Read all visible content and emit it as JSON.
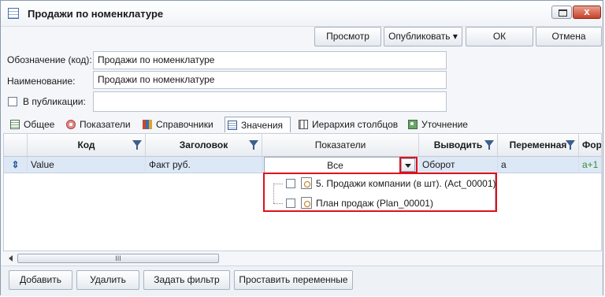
{
  "window": {
    "title": "Продажи по номенклатуре",
    "close_label": "x"
  },
  "toolbar": {
    "preview_label": "Просмотр",
    "publish_label": "Опубликовать ▾",
    "ok_label": "ОК",
    "cancel_label": "Отмена"
  },
  "form": {
    "code_label": "Обозначение (код):",
    "code_value": "Продажи по номенклатуре",
    "name_label": "Наименование:",
    "name_value": "Продажи по номенклатуре",
    "publication_label": "В публикации:",
    "publication_value": ""
  },
  "tabs": [
    {
      "label": "Общее",
      "icon": "list-icon"
    },
    {
      "label": "Показатели",
      "icon": "indicators-icon"
    },
    {
      "label": "Справочники",
      "icon": "books-icon"
    },
    {
      "label": "Значения",
      "icon": "table-icon",
      "active": true
    },
    {
      "label": "Иерархия столбцов",
      "icon": "hierarchy-icon"
    },
    {
      "label": "Уточнение",
      "icon": "refine-icon"
    }
  ],
  "grid": {
    "columns": [
      "Код",
      "Заголовок",
      "Показатели",
      "Выводить",
      "Переменная",
      "Форм"
    ],
    "row": {
      "code": "Value",
      "title": "Факт руб.",
      "indicators": "Все",
      "output": "Оборот",
      "variable": "a",
      "formula": "a+1"
    }
  },
  "dropdown": {
    "items": [
      "5. Продажи компании (в шт). (Act_00001)",
      "План продаж (Plan_00001)"
    ]
  },
  "scrollbar": {
    "thumb_glyph": "III"
  },
  "bottom_buttons": {
    "add_label": "Добавить",
    "delete_label": "Удалить",
    "filter_label": "Задать фильтр",
    "variables_label": "Проставить переменные"
  },
  "colors": {
    "highlight": "#e0101a",
    "selected_row": "#dde8f6"
  }
}
